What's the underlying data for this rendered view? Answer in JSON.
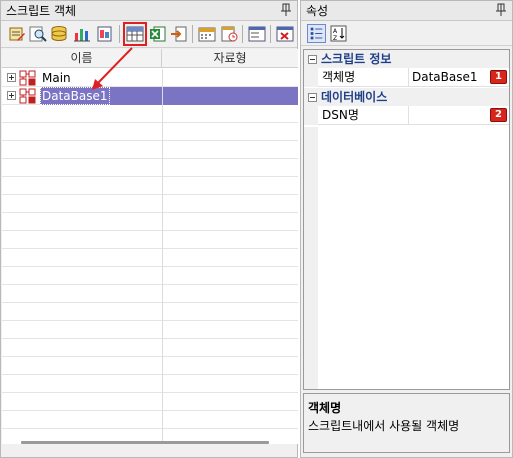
{
  "script_panel": {
    "title": "스크립트 객체",
    "columns": {
      "name": "이름",
      "type": "자료형"
    },
    "tree": [
      {
        "label": "Main",
        "type": ""
      },
      {
        "label": "DataBase1",
        "type": ""
      }
    ]
  },
  "property_panel": {
    "title": "속성",
    "categories": [
      {
        "label": "스크립트 정보",
        "props": [
          {
            "name": "객체명",
            "value": "DataBase1",
            "badge": "1"
          }
        ]
      },
      {
        "label": "데이터베이스",
        "props": [
          {
            "name": "DSN명",
            "value": "",
            "badge": "2"
          }
        ]
      }
    ],
    "description": {
      "title": "객체명",
      "text": "스크립트내에서 사용될 객체명"
    }
  },
  "colors": {
    "selection": "#7b73c4",
    "badge": "#d8261e",
    "category_text": "#1f3f8a",
    "annotation": "#e02020"
  }
}
